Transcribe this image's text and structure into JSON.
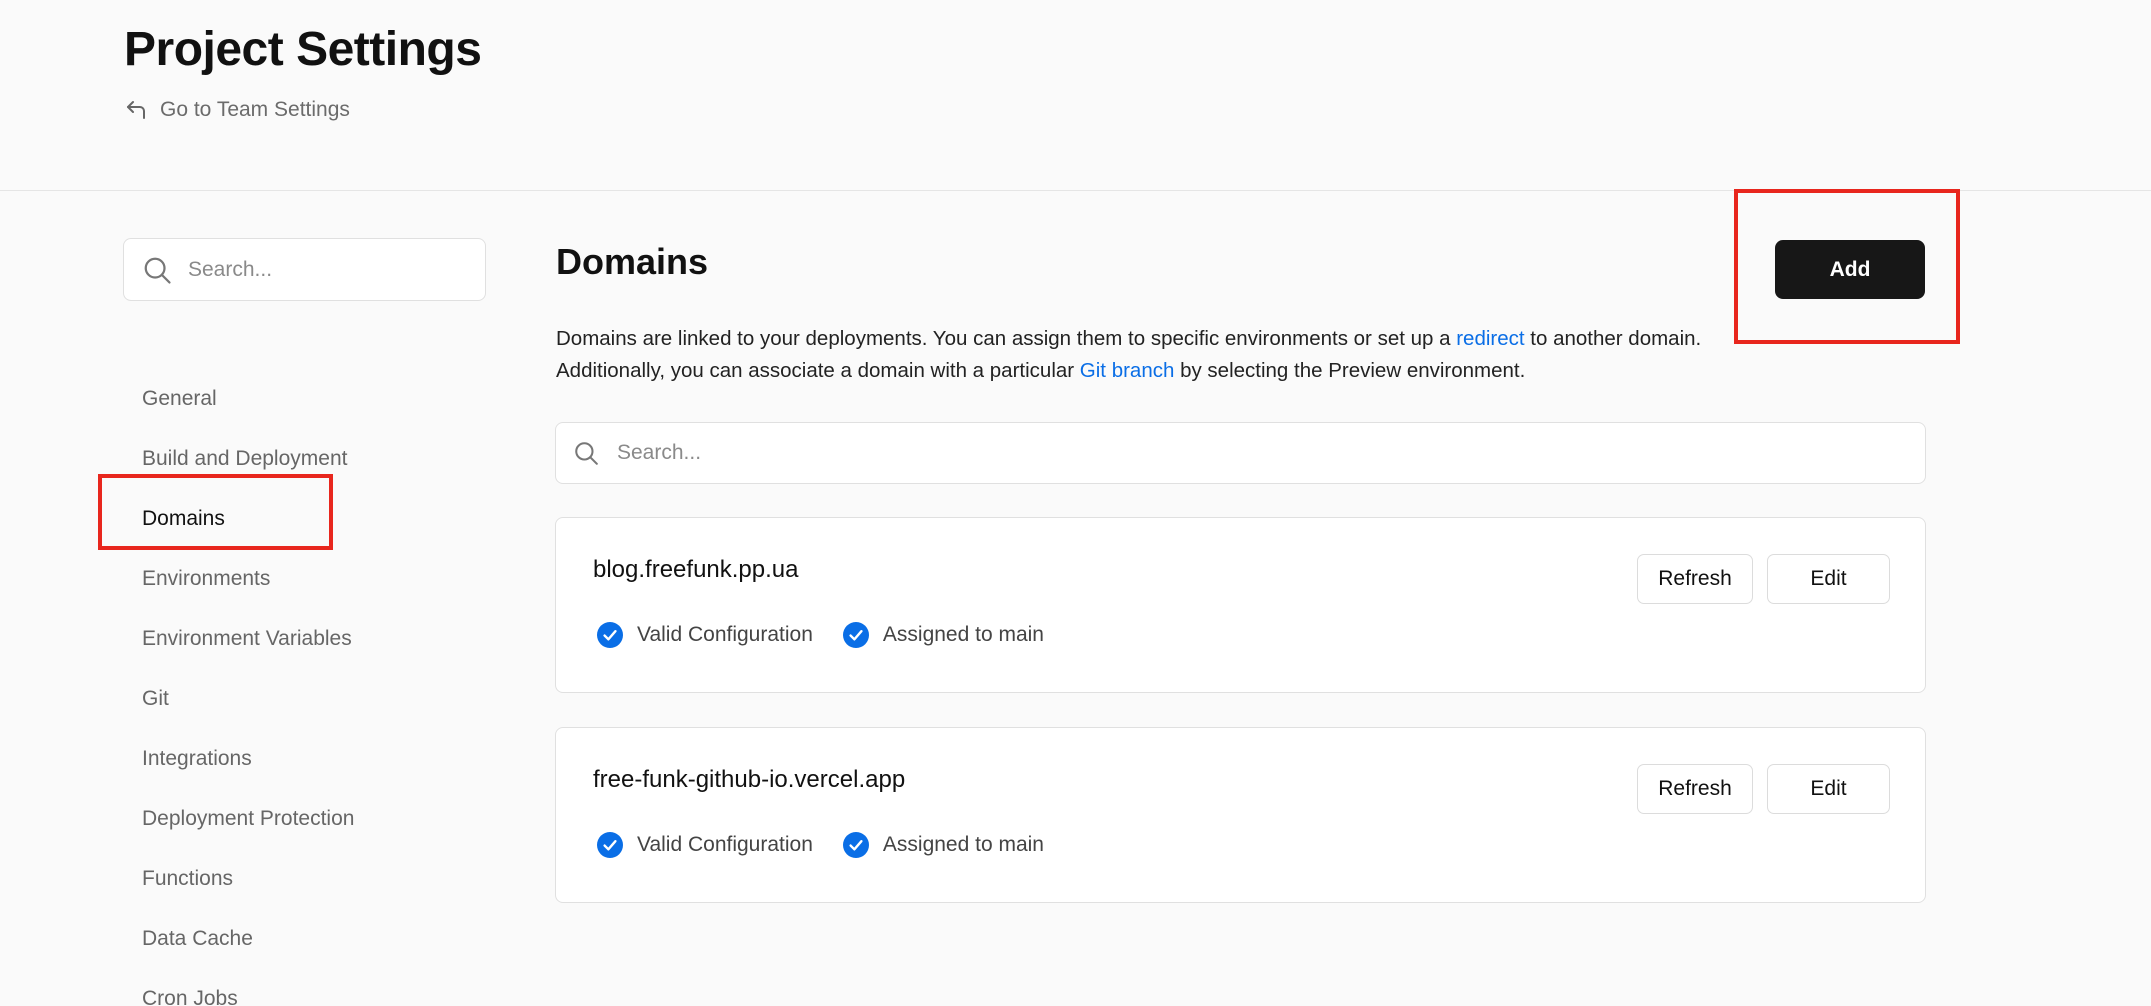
{
  "header": {
    "title": "Project Settings",
    "back_link": "Go to Team Settings"
  },
  "sidebar": {
    "search_placeholder": "Search...",
    "items": [
      {
        "label": "General"
      },
      {
        "label": "Build and Deployment"
      },
      {
        "label": "Domains"
      },
      {
        "label": "Environments"
      },
      {
        "label": "Environment Variables"
      },
      {
        "label": "Git"
      },
      {
        "label": "Integrations"
      },
      {
        "label": "Deployment Protection"
      },
      {
        "label": "Functions"
      },
      {
        "label": "Data Cache"
      },
      {
        "label": "Cron Jobs"
      }
    ],
    "active_item": "Domains"
  },
  "main": {
    "title": "Domains",
    "add_label": "Add",
    "description": {
      "part1": "Domains are linked to your deployments. You can assign them to specific environments or set up a ",
      "link1": "redirect",
      "part2": " to another domain.",
      "part3": "Additionally, you can associate a domain with a particular ",
      "link2": "Git branch",
      "part4": " by selecting the Preview environment."
    },
    "search_placeholder": "Search...",
    "domains": [
      {
        "name": "blog.freefunk.pp.ua",
        "status1": "Valid Configuration",
        "status2": "Assigned to main",
        "refresh_label": "Refresh",
        "edit_label": "Edit"
      },
      {
        "name": "free-funk-github-io.vercel.app",
        "status1": "Valid Configuration",
        "status2": "Assigned to main",
        "refresh_label": "Refresh",
        "edit_label": "Edit"
      }
    ]
  },
  "colors": {
    "accent_link": "#0a6ee6",
    "check_blue": "#0a6ee6",
    "primary_button": "#171717",
    "highlight_red": "#e8261d"
  },
  "icons": {
    "back": "corner-up-left-icon",
    "search": "search-icon",
    "check": "check-circle-icon"
  }
}
